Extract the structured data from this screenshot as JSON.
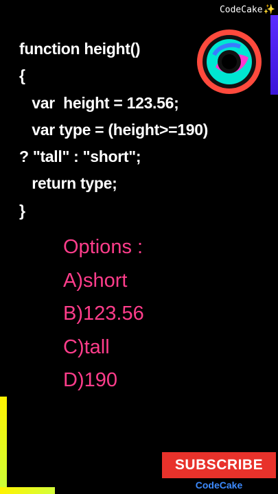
{
  "brand": {
    "top_label": "CodeCake",
    "sparkle": "✨",
    "bottom_label": "CodeCake"
  },
  "logo": {
    "icon": "ring-logo-icon",
    "colors": {
      "outer": "#ff4a3d",
      "ring": "#00e6d2",
      "accent": "#ff3ad0"
    }
  },
  "code": {
    "lines": [
      "function height()",
      "{",
      "   var  height = 123.56;",
      "   var type = (height>=190)",
      "? \"tall\" : \"short\";",
      "   return type;",
      "}"
    ]
  },
  "options": {
    "title": "Options :",
    "items": [
      "A)short",
      "B)123.56",
      "C)tall",
      "D)190"
    ]
  },
  "subscribe_label": "SUBSCRIBE",
  "colors": {
    "options_text": "#ff3d8b",
    "subscribe_bg": "#e8322b",
    "brand_bottom": "#3d8bff",
    "frame": "#fff200"
  }
}
